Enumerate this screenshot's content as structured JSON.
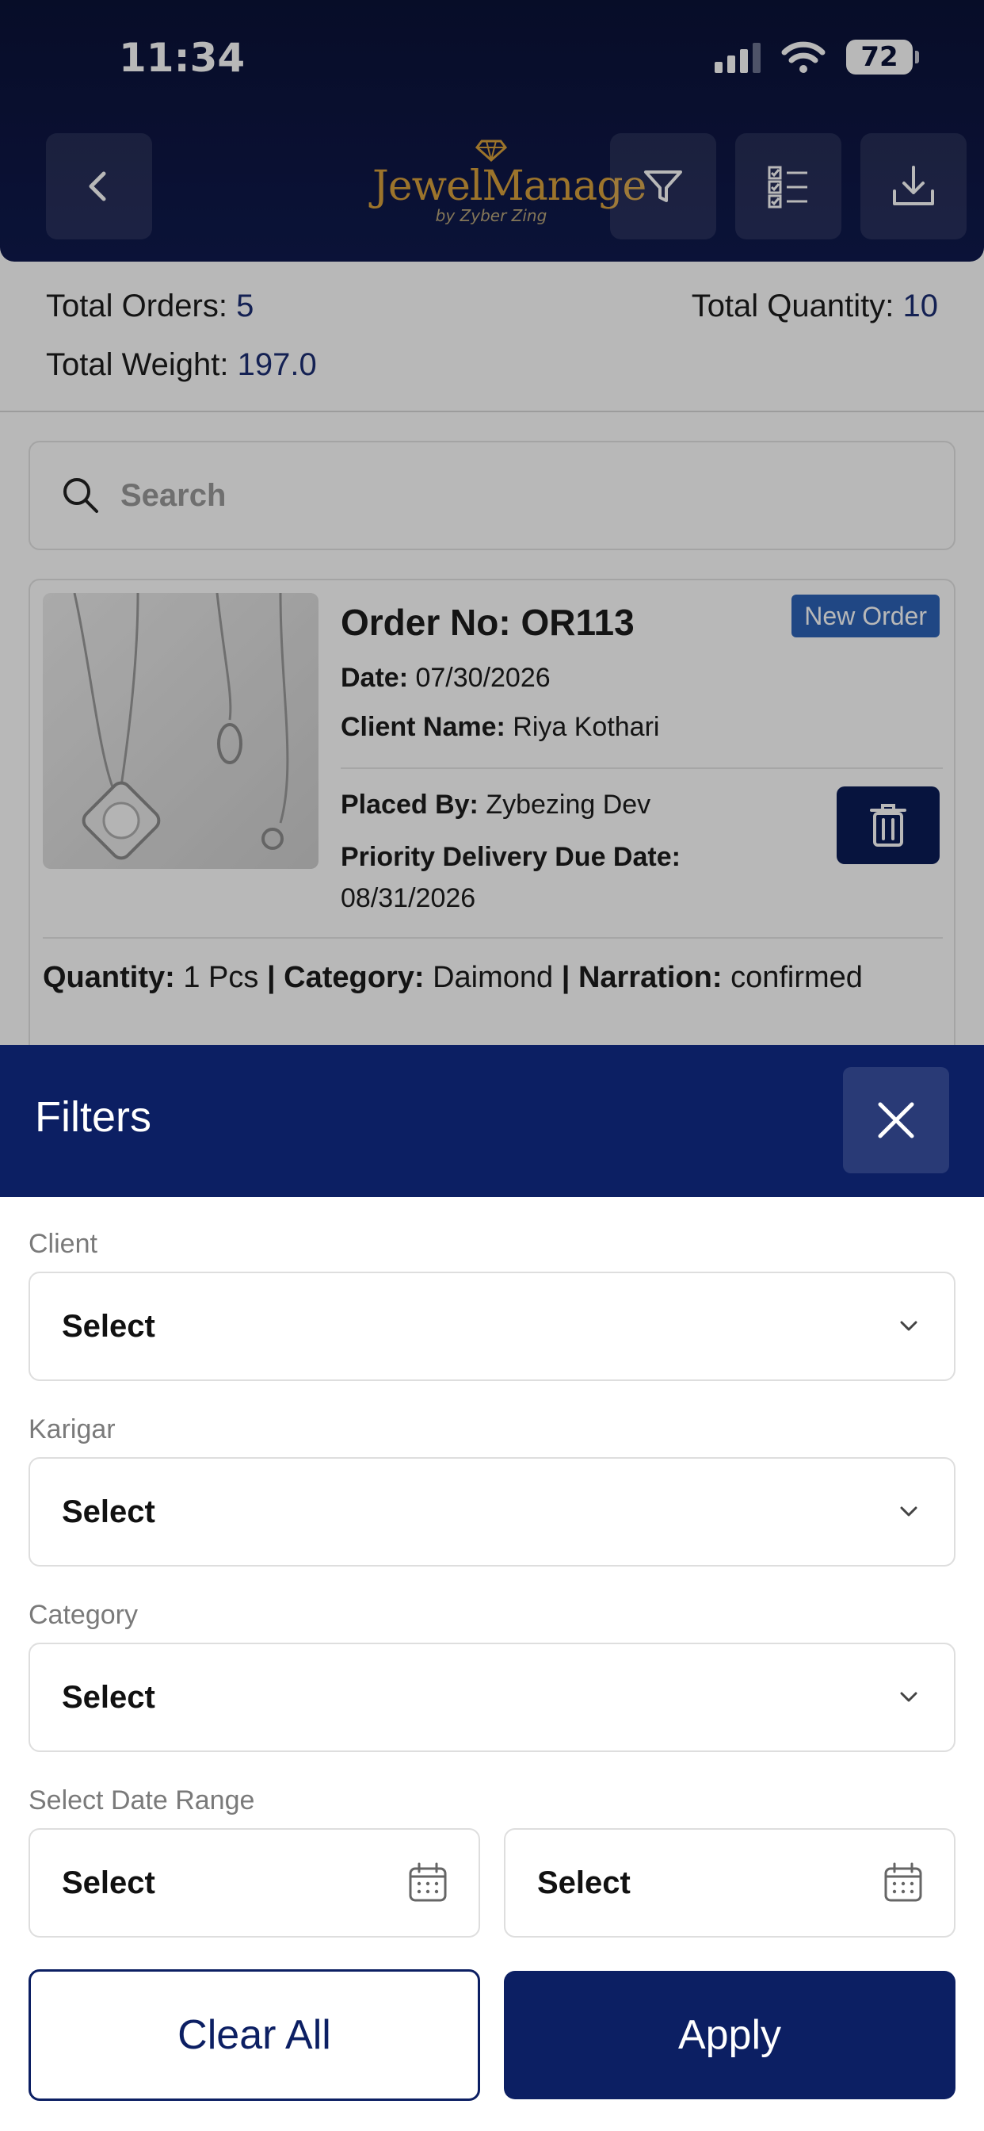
{
  "status_bar": {
    "time": "11:34",
    "battery": "72",
    "icons": [
      "cellular-signal-icon",
      "wifi-icon",
      "battery-icon"
    ]
  },
  "header": {
    "logo_text": "JewelManage",
    "logo_subtitle": "by Zyber Zing",
    "icons": [
      "chevron-left-icon",
      "filter-icon",
      "checklist-icon",
      "download-icon"
    ]
  },
  "summary": {
    "total_orders_label": "Total Orders:",
    "total_orders_value": "5",
    "total_quantity_label": "Total Quantity:",
    "total_quantity_value": "10",
    "total_weight_label": "Total Weight:",
    "total_weight_value": "197.0"
  },
  "search": {
    "placeholder": "Search",
    "value": ""
  },
  "order_card": {
    "order_no_label": "Order No:",
    "order_no": "OR113",
    "badge": "New Order",
    "date_label": "Date:",
    "date": "07/30/2026",
    "client_label": "Client Name:",
    "client": "Riya Kothari",
    "placed_by_label": "Placed By:",
    "placed_by": "Zybezing Dev",
    "priority_label": "Priority Delivery Due Date:",
    "priority_date": "08/31/2026",
    "quantity_label": "Quantity:",
    "quantity": "1 Pcs",
    "category_label": "Category:",
    "category": "Daimond",
    "narration_label": "Narration:",
    "narration": "confirmed"
  },
  "filters": {
    "title": "Filters",
    "client_label": "Client",
    "client_value": "Select",
    "karigar_label": "Karigar",
    "karigar_value": "Select",
    "category_label": "Category",
    "category_value": "Select",
    "date_range_label": "Select Date Range",
    "date_from_value": "Select",
    "date_to_value": "Select",
    "clear_label": "Clear All",
    "apply_label": "Apply"
  },
  "colors": {
    "header_bg": "#0b1238",
    "sheet_header_bg": "#0c1f63",
    "value_blue": "#1d2f74",
    "badge_blue": "#2d63b8",
    "logo_gold": "#d9a13c"
  }
}
